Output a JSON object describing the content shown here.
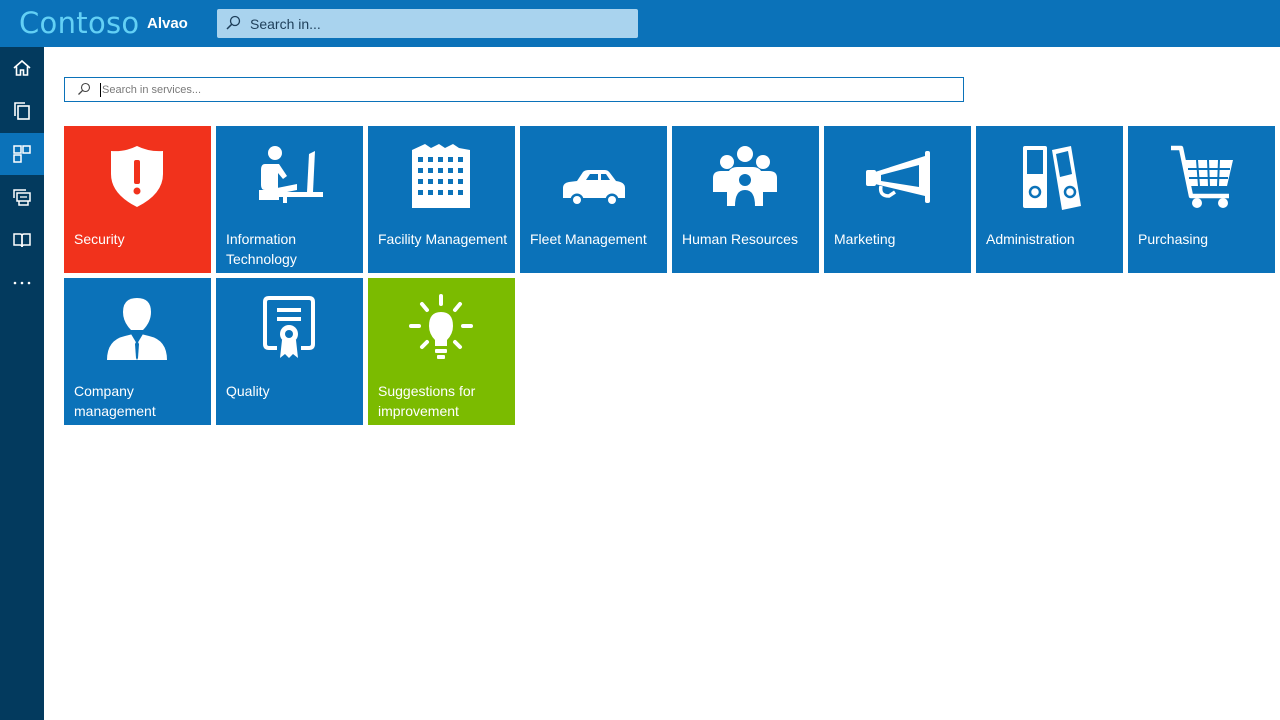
{
  "header": {
    "brand": "Contoso",
    "app_name": "Alvao",
    "search_placeholder": "Search in..."
  },
  "sidebar": {
    "items": [
      {
        "name": "home-icon",
        "active": false
      },
      {
        "name": "requests-icon",
        "active": false
      },
      {
        "name": "service-catalog-icon",
        "active": true
      },
      {
        "name": "tickets-icon",
        "active": false
      },
      {
        "name": "knowledge-base-icon",
        "active": false
      },
      {
        "name": "more-icon",
        "active": false
      }
    ]
  },
  "services": {
    "search_placeholder": "Search in services...",
    "tiles": [
      {
        "label": "Security",
        "icon": "shield-exclamation-icon",
        "color": "#f1321c"
      },
      {
        "label": "Information Technology",
        "icon": "person-at-computer-icon",
        "color": "#0b72b9"
      },
      {
        "label": "Facility Management",
        "icon": "building-icon",
        "color": "#0b72b9"
      },
      {
        "label": "Fleet Management",
        "icon": "car-icon",
        "color": "#0b72b9"
      },
      {
        "label": "Human Resources",
        "icon": "people-group-icon",
        "color": "#0b72b9"
      },
      {
        "label": "Marketing",
        "icon": "megaphone-icon",
        "color": "#0b72b9"
      },
      {
        "label": "Administration",
        "icon": "binders-icon",
        "color": "#0b72b9"
      },
      {
        "label": "Purchasing",
        "icon": "shopping-cart-icon",
        "color": "#0b72b9"
      },
      {
        "label": "Company management",
        "icon": "manager-icon",
        "color": "#0b72b9"
      },
      {
        "label": "Quality",
        "icon": "certificate-icon",
        "color": "#0b72b9"
      },
      {
        "label": "Suggestions for improvement",
        "icon": "lightbulb-icon",
        "color": "#7bbb00"
      }
    ]
  }
}
